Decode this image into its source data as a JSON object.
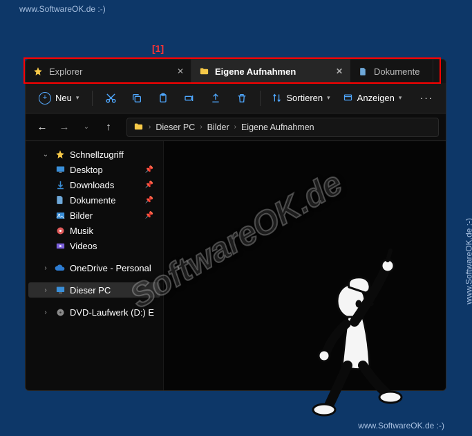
{
  "watermark": "www.SoftwareOK.de :-)",
  "big_watermark": "SoftwareOK.de",
  "annotation": "[1]",
  "tabs": [
    {
      "label": "Explorer",
      "active": false
    },
    {
      "label": "Eigene Aufnahmen",
      "active": true
    },
    {
      "label": "Dokumente",
      "active": false
    }
  ],
  "toolbar": {
    "new_label": "Neu",
    "sort_label": "Sortieren",
    "view_label": "Anzeigen"
  },
  "breadcrumb": [
    "Dieser PC",
    "Bilder",
    "Eigene Aufnahmen"
  ],
  "sidebar": {
    "quick": "Schnellzugriff",
    "items": [
      {
        "label": "Desktop"
      },
      {
        "label": "Downloads"
      },
      {
        "label": "Dokumente"
      },
      {
        "label": "Bilder"
      },
      {
        "label": "Musik"
      },
      {
        "label": "Videos"
      }
    ],
    "onedrive": "OneDrive - Personal",
    "thispc": "Dieser PC",
    "dvd": "DVD-Laufwerk (D:) E"
  }
}
